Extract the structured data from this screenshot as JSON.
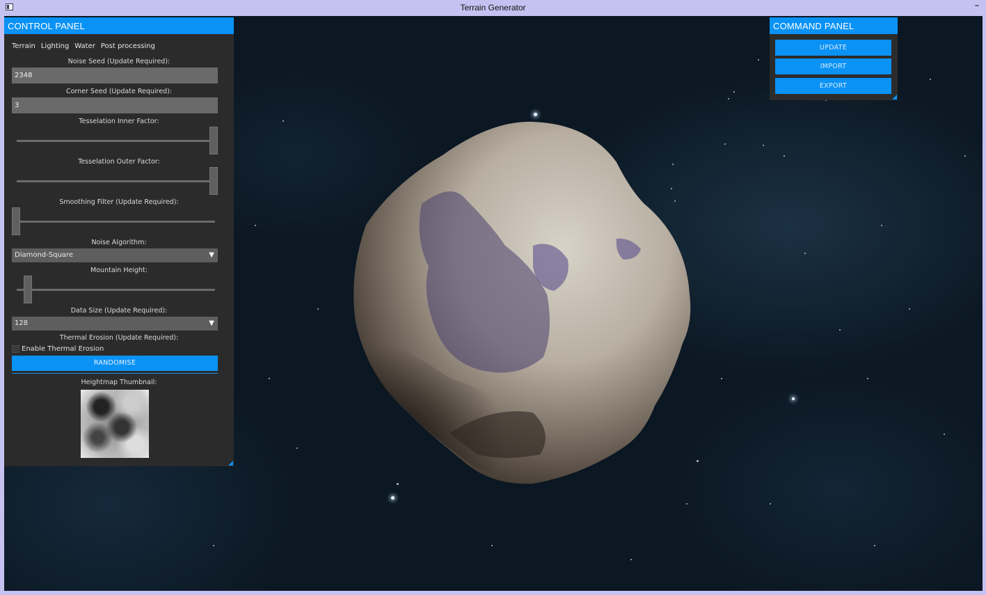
{
  "window": {
    "title": "Terrain Generator",
    "minimize_glyph": "–"
  },
  "colors": {
    "accent": "#0a92f5",
    "panel_bg": "#2b2b2b",
    "titlebar": "#c5c2f1",
    "space_bg": "#0b1722"
  },
  "control_panel": {
    "title": "CONTROL PANEL",
    "tabs": [
      "Terrain",
      "Lighting",
      "Water",
      "Post processing"
    ],
    "noise_seed": {
      "label": "Noise Seed (Update Required):",
      "value": "2348"
    },
    "corner_seed": {
      "label": "Corner Seed (Update Required):",
      "value": "3"
    },
    "tess_inner": {
      "label": "Tesselation Inner Factor:",
      "level": 1.0
    },
    "tess_outer": {
      "label": "Tesselation Outer Factor:",
      "level": 1.0
    },
    "smoothing": {
      "label": "Smoothing Filter (Update Required):",
      "level": 0.0
    },
    "noise_algorithm": {
      "label": "Noise Algorithm:",
      "selected": "Diamond-Square"
    },
    "mountain_height": {
      "label": "Mountain Height:",
      "level": 0.06
    },
    "data_size": {
      "label": "Data Size (Update Required):",
      "selected": "128"
    },
    "thermal_erosion": {
      "label": "Thermal Erosion (Update Required):",
      "checkbox_label": "Enable Thermal Erosion",
      "checked": false
    },
    "randomise_label": "RANDOMISE",
    "thumbnail_label": "Heightmap Thumbnail:"
  },
  "command_panel": {
    "title": "COMMAND PANEL",
    "buttons": [
      "UPDATE",
      "IMPORT",
      "EXPORT"
    ]
  }
}
